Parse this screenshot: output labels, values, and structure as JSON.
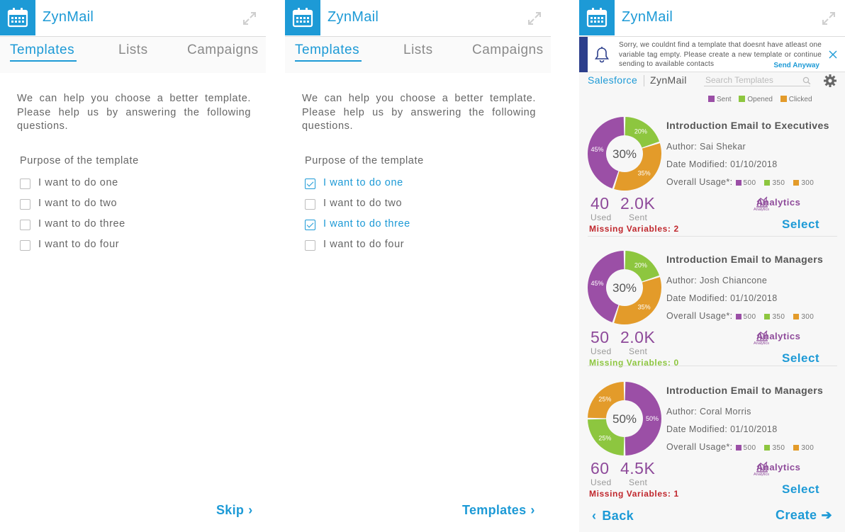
{
  "app": {
    "title": "ZynMail"
  },
  "tabs": [
    "Templates",
    "Lists",
    "Campaigns"
  ],
  "questionnaire": {
    "intro": "We can help you choose a better template. Please help us by answering the following questions.",
    "question": "Purpose of the template",
    "options": [
      "I want to do one",
      "I want to do two",
      "I want to do three",
      "I want to do four"
    ]
  },
  "panel1": {
    "checked": [
      false,
      false,
      false,
      false
    ],
    "footer_link": "Skip"
  },
  "panel2": {
    "checked": [
      true,
      false,
      true,
      false
    ],
    "footer_link": "Templates"
  },
  "panel3": {
    "alert": {
      "message": "Sorry, we couldnt find a template that doesnt have atleast one variable tag empty. Please create a new template or continue sending to available contacts",
      "action": "Send Anyway"
    },
    "source_tabs": [
      "Salesforce",
      "ZynMail"
    ],
    "search_placeholder": "Search Templates",
    "legend": [
      "Sent",
      "Opened",
      "Clicked"
    ],
    "usage_label": "Overall Usage*:",
    "usage_values": [
      "500",
      "350",
      "300"
    ],
    "used_label": "Used",
    "sent_label": "Sent",
    "analytics_label": "Analytics",
    "analytics_icon_caption": "Analytics",
    "select_label": "Select",
    "back_label": "Back",
    "create_label": "Create",
    "cards": [
      {
        "title": "Introduction Email to Executives",
        "author": "Author: Sai Shekar",
        "date": "Date Modified: 01/10/2018",
        "center": "30%",
        "used": "40",
        "sent": "2.0K",
        "missing": "Missing Variables: 2",
        "missing_color": "#c0272d",
        "chart_data": {
          "type": "pie",
          "slices": [
            {
              "label": "Opened",
              "value": 20,
              "text": "20%",
              "color": "#8dc63f"
            },
            {
              "label": "Clicked",
              "value": 35,
              "text": "35%",
              "color": "#e39b2a"
            },
            {
              "label": "Sent",
              "value": 45,
              "text": "45%",
              "color": "#9b4fa6"
            }
          ]
        }
      },
      {
        "title": "Introduction Email to Managers",
        "author": "Author: Josh Chiancone",
        "date": "Date Modified: 01/10/2018",
        "center": "30%",
        "used": "50",
        "sent": "2.0K",
        "missing": "Missing Variables: 0",
        "missing_color": "#8dc63f",
        "chart_data": {
          "type": "pie",
          "slices": [
            {
              "label": "Opened",
              "value": 20,
              "text": "20%",
              "color": "#8dc63f"
            },
            {
              "label": "Clicked",
              "value": 35,
              "text": "35%",
              "color": "#e39b2a"
            },
            {
              "label": "Sent",
              "value": 45,
              "text": "45%",
              "color": "#9b4fa6"
            }
          ]
        }
      },
      {
        "title": "Introduction Email to Managers",
        "author": "Author: Coral Morris",
        "date": "Date Modified: 01/10/2018",
        "center": "50%",
        "used": "60",
        "sent": "4.5K",
        "missing": "Missing Variables: 1",
        "missing_color": "#c0272d",
        "chart_data": {
          "type": "pie",
          "slices": [
            {
              "label": "Sent",
              "value": 50,
              "text": "50%",
              "color": "#9b4fa6"
            },
            {
              "label": "Opened",
              "value": 25,
              "text": "25%",
              "color": "#8dc63f"
            },
            {
              "label": "Clicked",
              "value": 25,
              "text": "25%",
              "color": "#e39b2a"
            }
          ]
        }
      }
    ]
  },
  "colors": {
    "accent": "#1d9ad6",
    "purple": "#9b4fa6",
    "green": "#8dc63f",
    "orange": "#e39b2a",
    "alert_bar": "#2c3f8c"
  }
}
